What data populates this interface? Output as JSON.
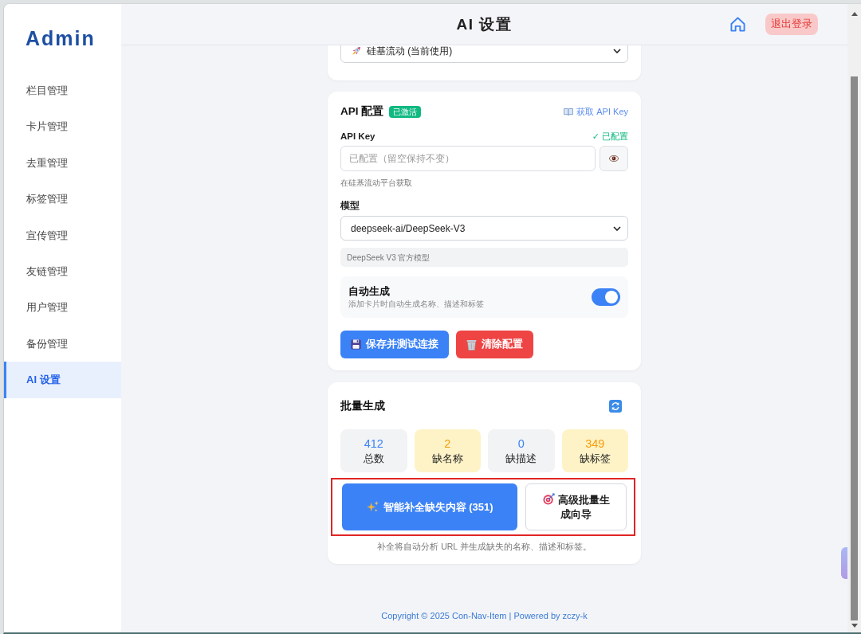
{
  "sidebar": {
    "logo": "Admin",
    "items": [
      {
        "label": "栏目管理",
        "selected": false
      },
      {
        "label": "卡片管理",
        "selected": false
      },
      {
        "label": "去重管理",
        "selected": false
      },
      {
        "label": "标签管理",
        "selected": false
      },
      {
        "label": "宣传管理",
        "selected": false
      },
      {
        "label": "友链管理",
        "selected": false
      },
      {
        "label": "用户管理",
        "selected": false
      },
      {
        "label": "备份管理",
        "selected": false
      },
      {
        "label": "AI 设置",
        "selected": true
      }
    ]
  },
  "header": {
    "title": "AI 设置",
    "logout_button": "退出登录"
  },
  "provider_card": {
    "select_value": "硅基流动 (当前使用)"
  },
  "api_card": {
    "title": "API 配置",
    "status_badge": "已激活",
    "key_link": "获取 API Key",
    "key_label": "API Key",
    "key_status": "✓ 已配置",
    "key_placeholder": "已配置（留空保持不变）",
    "key_hint": "在硅基流动平台获取",
    "model_label": "模型",
    "model_value": "deepseek-ai/DeepSeek-V3",
    "model_info": "DeepSeek V3 官方模型",
    "auto_generate": {
      "title": "自动生成",
      "description": "添加卡片时自动生成名称、描述和标签",
      "on": true
    },
    "buttons": [
      {
        "label": "保存并测试连接",
        "kind": "save"
      },
      {
        "label": "清除配置",
        "kind": "clear"
      }
    ]
  },
  "batch_card": {
    "title": "批量生成",
    "stats": [
      {
        "value": "412",
        "label": "总数",
        "kind": "normal"
      },
      {
        "value": "2",
        "label": "缺名称",
        "kind": "warning"
      },
      {
        "value": "0",
        "label": "缺描述",
        "kind": "normal"
      },
      {
        "value": "349",
        "label": "缺标签",
        "kind": "warning"
      }
    ],
    "actions_highlighted": true,
    "buttons": [
      {
        "label": "智能补全缺失内容 (351)",
        "kind": "primary"
      },
      {
        "label": "高级批量生成向导",
        "kind": "outline"
      }
    ],
    "note": "补全将自动分析 URL 并生成缺失的名称、描述和标签。"
  },
  "footer": {
    "text": "Copyright © 2025 Con-Nav-Item | Powered by zczy-k"
  }
}
